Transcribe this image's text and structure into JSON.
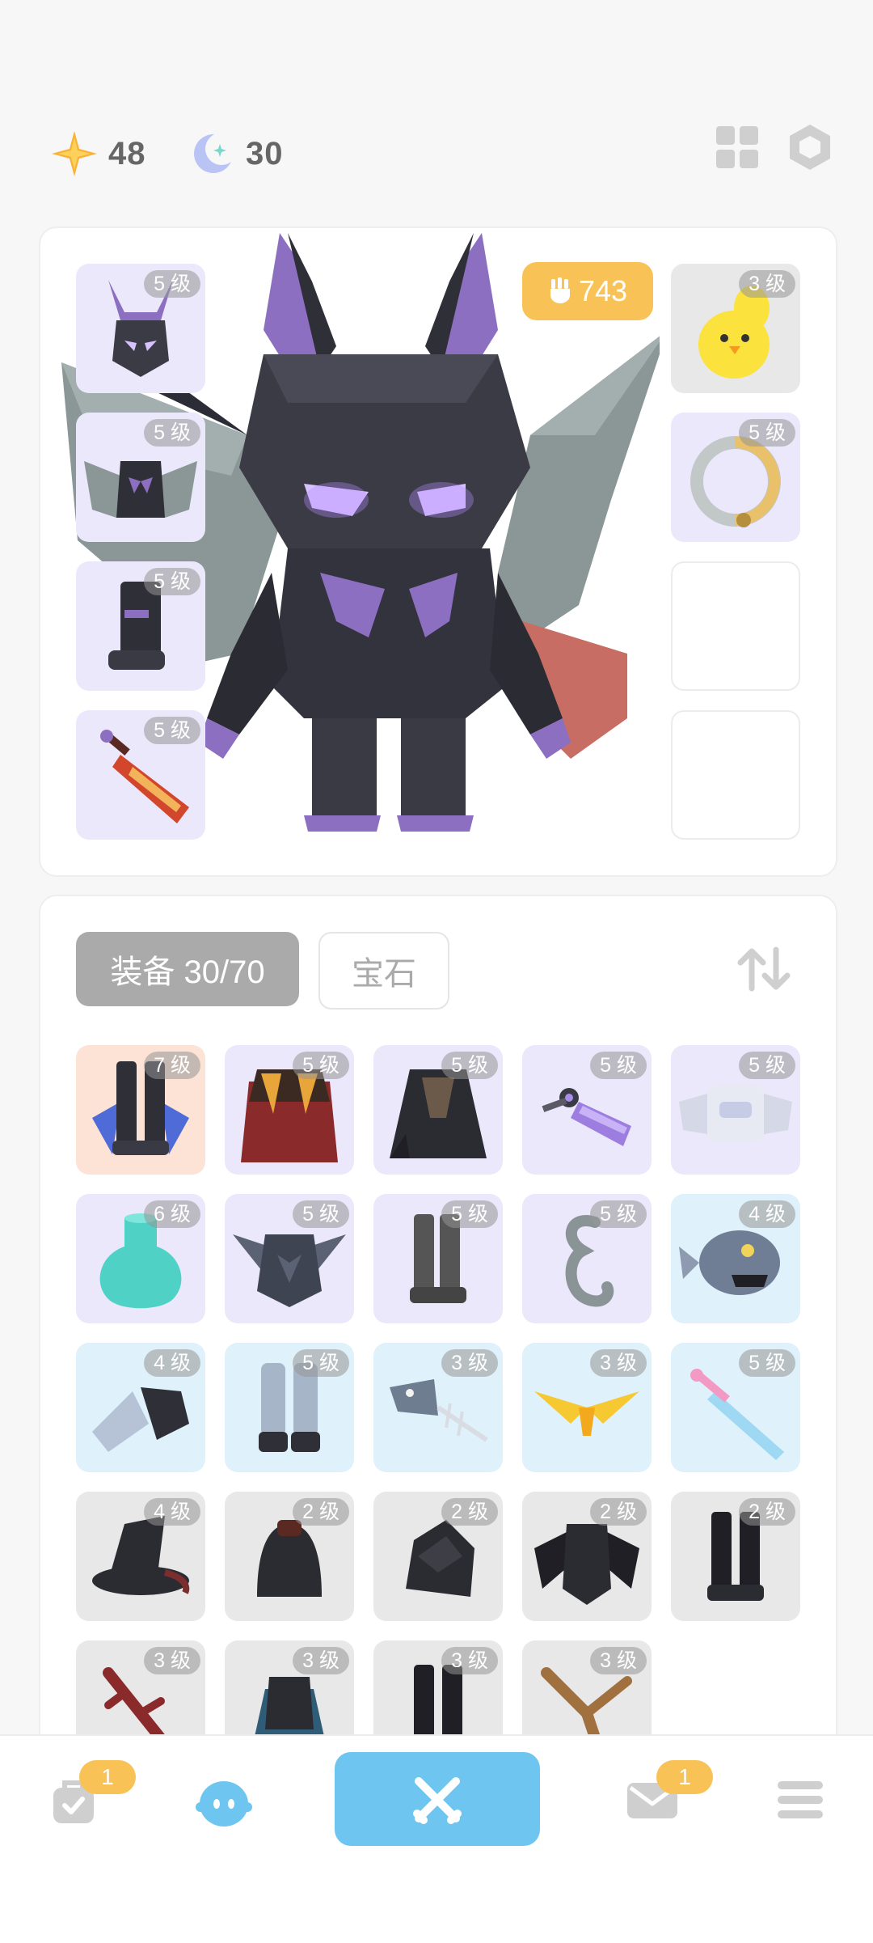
{
  "currency": {
    "stars": "48",
    "moons": "30"
  },
  "character": {
    "power": "743",
    "left_slots": [
      {
        "level": "5 级",
        "item": "demon-helmet"
      },
      {
        "level": "5 级",
        "item": "bat-wing-armor"
      },
      {
        "level": "5 级",
        "item": "dark-boots"
      },
      {
        "level": "5 级",
        "item": "flame-sword"
      }
    ],
    "right_slots": [
      {
        "level": "3 级",
        "item": "yellow-chick-pet"
      },
      {
        "level": "5 级",
        "item": "serpent-ring"
      },
      {
        "level": "",
        "item": "empty"
      },
      {
        "level": "",
        "item": "empty"
      }
    ]
  },
  "inventory": {
    "tabs": {
      "equipment": "装备 30/70",
      "gems": "宝石"
    },
    "items": [
      {
        "level": "7 级",
        "item": "dark-crystal-boots",
        "bg": "peach"
      },
      {
        "level": "5 级",
        "item": "red-gold-cape",
        "bg": "lav"
      },
      {
        "level": "5 级",
        "item": "dark-cloak",
        "bg": "lav"
      },
      {
        "level": "5 级",
        "item": "purple-crystal-blade",
        "bg": "lav"
      },
      {
        "level": "5 级",
        "item": "white-robot-armor",
        "bg": "lav"
      },
      {
        "level": "6 级",
        "item": "teal-potion",
        "bg": "lav"
      },
      {
        "level": "5 级",
        "item": "spiky-armor",
        "bg": "lav"
      },
      {
        "level": "5 级",
        "item": "grey-boots",
        "bg": "lav"
      },
      {
        "level": "5 级",
        "item": "hook-ring",
        "bg": "lav"
      },
      {
        "level": "4 级",
        "item": "fish-helmet",
        "bg": "sky"
      },
      {
        "level": "4 级",
        "item": "wing-glove",
        "bg": "sky"
      },
      {
        "level": "5 级",
        "item": "claw-legs",
        "bg": "sky"
      },
      {
        "level": "3 级",
        "item": "fish-bone",
        "bg": "sky"
      },
      {
        "level": "3 级",
        "item": "golden-wings",
        "bg": "sky"
      },
      {
        "level": "5 级",
        "item": "pink-crystal-sword",
        "bg": "sky"
      },
      {
        "level": "4 级",
        "item": "witch-hat",
        "bg": "grey"
      },
      {
        "level": "2 级",
        "item": "black-hood",
        "bg": "grey"
      },
      {
        "level": "2 级",
        "item": "rock-helmet",
        "bg": "grey"
      },
      {
        "level": "2 级",
        "item": "black-armor",
        "bg": "grey"
      },
      {
        "level": "2 级",
        "item": "black-boots",
        "bg": "grey"
      },
      {
        "level": "3 级",
        "item": "red-branch",
        "bg": "grey"
      },
      {
        "level": "3 级",
        "item": "blue-armor",
        "bg": "grey"
      },
      {
        "level": "3 级",
        "item": "black-legs",
        "bg": "grey"
      },
      {
        "level": "3 级",
        "item": "wooden-stick",
        "bg": "grey"
      }
    ]
  },
  "nav": {
    "quest_badge": "1",
    "mail_badge": "1"
  }
}
